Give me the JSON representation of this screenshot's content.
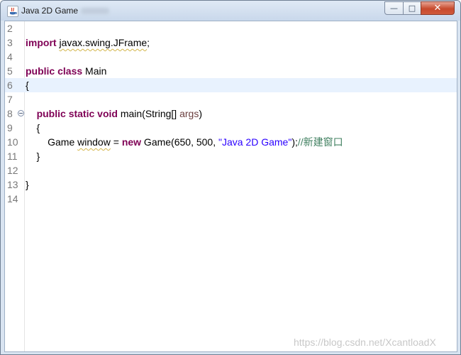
{
  "window": {
    "title": "Java 2D Game",
    "controls": {
      "minimize": "—",
      "maximize": "□",
      "close": "✕"
    }
  },
  "editor": {
    "lines": [
      {
        "num": "2",
        "parts": []
      },
      {
        "num": "3",
        "parts": [
          {
            "t": "import",
            "c": "kw"
          },
          {
            "t": " "
          },
          {
            "t": "javax.swing.JFrame",
            "c": "squig"
          },
          {
            "t": ";"
          }
        ]
      },
      {
        "num": "4",
        "parts": []
      },
      {
        "num": "5",
        "parts": [
          {
            "t": "public",
            "c": "kw"
          },
          {
            "t": " "
          },
          {
            "t": "class",
            "c": "kw"
          },
          {
            "t": " Main"
          }
        ]
      },
      {
        "num": "6",
        "parts": [
          {
            "t": "{"
          }
        ],
        "current": true
      },
      {
        "num": "7",
        "parts": []
      },
      {
        "num": "8",
        "fold": true,
        "parts": [
          {
            "t": "    "
          },
          {
            "t": "public",
            "c": "kw"
          },
          {
            "t": " "
          },
          {
            "t": "static",
            "c": "kw"
          },
          {
            "t": " "
          },
          {
            "t": "void",
            "c": "kw"
          },
          {
            "t": " main(String[] "
          },
          {
            "t": "args",
            "c": "param"
          },
          {
            "t": ")"
          }
        ]
      },
      {
        "num": "9",
        "parts": [
          {
            "t": "    {"
          }
        ]
      },
      {
        "num": "10",
        "parts": [
          {
            "t": "        Game "
          },
          {
            "t": "window",
            "c": "squig"
          },
          {
            "t": " = "
          },
          {
            "t": "new",
            "c": "kw"
          },
          {
            "t": " Game(650, 500, "
          },
          {
            "t": "\"Java 2D Game\"",
            "c": "str"
          },
          {
            "t": ");"
          },
          {
            "t": "//新建窗口",
            "c": "cmt"
          }
        ]
      },
      {
        "num": "11",
        "parts": [
          {
            "t": "    }"
          }
        ]
      },
      {
        "num": "12",
        "parts": []
      },
      {
        "num": "13",
        "parts": [
          {
            "t": "}"
          }
        ]
      },
      {
        "num": "14",
        "parts": []
      }
    ]
  },
  "watermark": "https://blog.csdn.net/XcantloadX"
}
